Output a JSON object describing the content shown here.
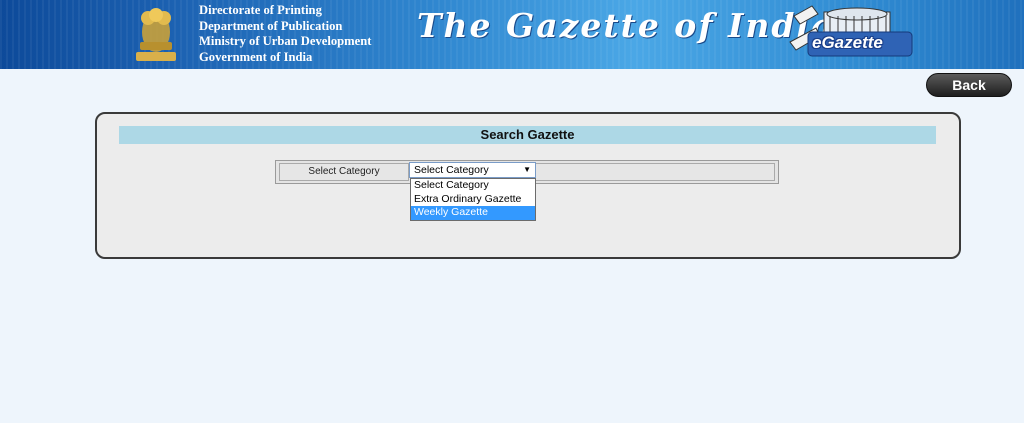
{
  "header": {
    "dept_lines": [
      "Directorate of Printing",
      "Department of Publication",
      "Ministry of Urban Development",
      "Government of India"
    ],
    "title": "The Gazette of India",
    "logo_text": "eGazette",
    "colors": {
      "banner_start": "#0d4a9a",
      "banner_mid": "#4aa7e6"
    }
  },
  "nav": {
    "back_label": "Back"
  },
  "panel": {
    "title": "Search Gazette",
    "category_label": "Select Category",
    "category_selected": "Select Category",
    "category_options": [
      "Select Category",
      "Extra Ordinary Gazette",
      "Weekly Gazette"
    ],
    "highlighted_option": "Weekly Gazette",
    "title_bg": "#add8e6"
  }
}
